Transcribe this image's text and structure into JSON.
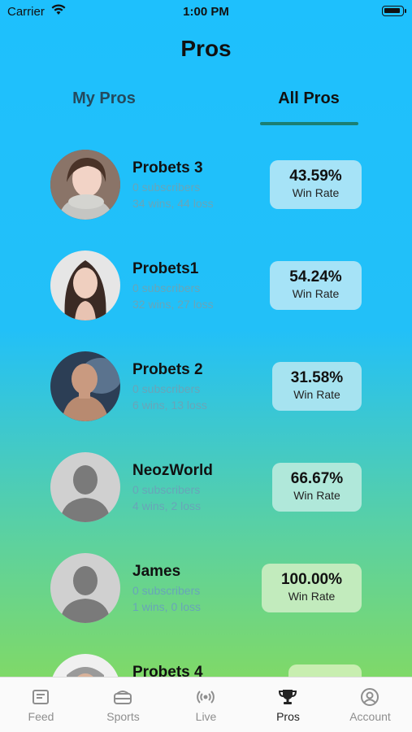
{
  "status_bar": {
    "carrier": "Carrier",
    "time": "1:00 PM"
  },
  "header": {
    "title": "Pros"
  },
  "tabs": [
    {
      "label": "My Pros",
      "active": false
    },
    {
      "label": "All Pros",
      "active": true
    }
  ],
  "pros": [
    {
      "name": "Probets 3",
      "subscribers": "0 subscribers",
      "record": "34 wins, 44 loss",
      "win_rate": "43.59%",
      "win_rate_label": "Win Rate",
      "avatar": "woman-gray-scarf-photo"
    },
    {
      "name": "Probets1",
      "subscribers": "0 subscribers",
      "record": "32 wins, 27 loss",
      "win_rate": "54.24%",
      "win_rate_label": "Win Rate",
      "avatar": "woman-dark-hair-photo"
    },
    {
      "name": "Probets 2",
      "subscribers": "0 subscribers",
      "record": "6 wins, 13 loss",
      "win_rate": "31.58%",
      "win_rate_label": "Win Rate",
      "avatar": "bald-man-smoke-photo"
    },
    {
      "name": "NeozWorld",
      "subscribers": "0 subscribers",
      "record": "4 wins, 2 loss",
      "win_rate": "66.67%",
      "win_rate_label": "Win Rate",
      "avatar": "default-avatar-icon"
    },
    {
      "name": "James",
      "subscribers": "0 subscribers",
      "record": "1 wins, 0 loss",
      "win_rate": "100.00%",
      "win_rate_label": "Win Rate",
      "avatar": "default-avatar-icon"
    },
    {
      "name": "Probets 4",
      "subscribers": "",
      "record": "",
      "win_rate": "",
      "win_rate_label": "",
      "avatar": "man-cap-photo"
    }
  ],
  "bottom_nav": [
    {
      "label": "Feed",
      "icon": "feed-icon",
      "active": false
    },
    {
      "label": "Sports",
      "icon": "sports-icon",
      "active": false
    },
    {
      "label": "Live",
      "icon": "live-icon",
      "active": false
    },
    {
      "label": "Pros",
      "icon": "trophy-icon",
      "active": true
    },
    {
      "label": "Account",
      "icon": "account-icon",
      "active": false
    }
  ],
  "colors": {
    "gradient_top": "#1ec0fd",
    "gradient_bottom": "#8ddc52",
    "tab_indicator": "#1b7f73",
    "subtext": "#68a5b9"
  }
}
